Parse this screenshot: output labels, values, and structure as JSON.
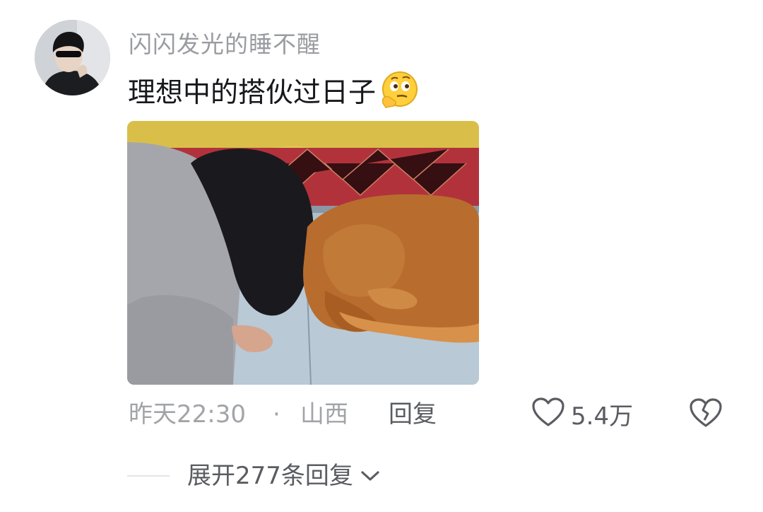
{
  "comment": {
    "username": "闪闪发光的睡不醒",
    "text": "理想中的搭伙过日子",
    "emoji": "thinking-face-icon",
    "time": "昨天22:30",
    "separator": "·",
    "location": "山西",
    "reply_label": "回复",
    "like_count": "5.4万",
    "expand_label": "展开277条回复"
  },
  "colors": {
    "username": "#9a9ca1",
    "text": "#17181c",
    "meta": "#a2a4a8",
    "action": "#5a5c61"
  }
}
